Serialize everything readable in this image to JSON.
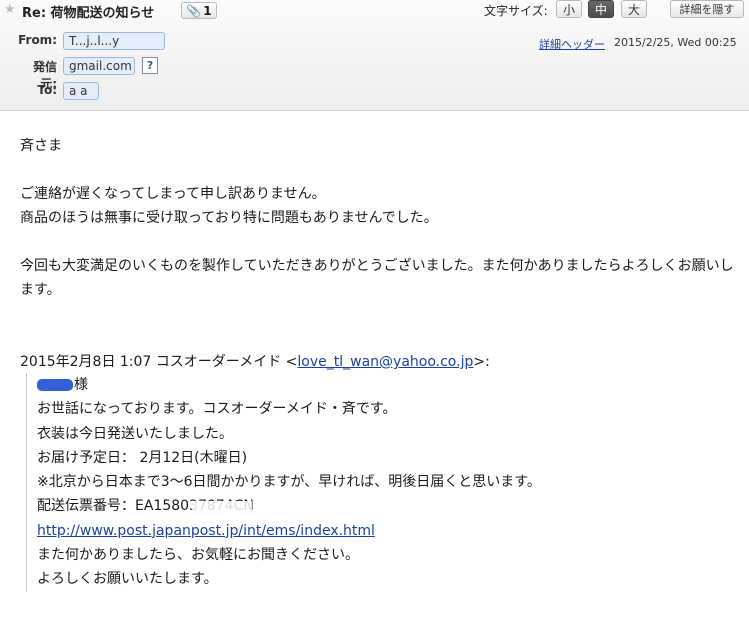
{
  "header": {
    "subject": "Re: 荷物配送の知らせ",
    "attachment_count": "1",
    "font_size_label": "文字サイズ:",
    "font_sizes": [
      "小",
      "中",
      "大"
    ],
    "hide_details_label": "詳細を隠す",
    "from_label": "From:",
    "from_value": "T...j..l...y",
    "sender_label": "発信元:",
    "sender_value": "gmail.com",
    "help_label": "?",
    "to_label": "To:",
    "to_value": "a a",
    "detail_header_link": "詳細ヘッダー",
    "datetime": "2015/2/25, Wed 00:25"
  },
  "body": {
    "greeting": "斉さま",
    "line1": "ご連絡が遅くなってしまって申し訳ありません。",
    "line2": "商品のほうは無事に受け取っており特に問題もありませんでした。",
    "line3": "今回も大変満足のいくものを製作していただきありがとうございました。また何かありましたらよろしくお願いします。"
  },
  "quote": {
    "header_prefix": "2015年2月8日 1:07 コスオーダーメイド <",
    "header_email": "love_tl_wan@yahoo.co.jp",
    "header_suffix": ">:",
    "salutation": "様",
    "lines": [
      "お世話になっております。コスオーダーメイド・斉です。",
      "衣装は今日発送いたしました。",
      "お届け予定日： 2月12日(木曜日)",
      "※北京から日本まで3〜6日間かかりますが、早ければ、明後日届くと思います。",
      "配送伝票番号：EA158037874CN"
    ],
    "link": "http://www.post.japanpost.jp/int/ems/index.html",
    "closing": [
      "また何かありましたら、お気軽にお聞きください。",
      "よろしくお願いいたします。"
    ]
  }
}
